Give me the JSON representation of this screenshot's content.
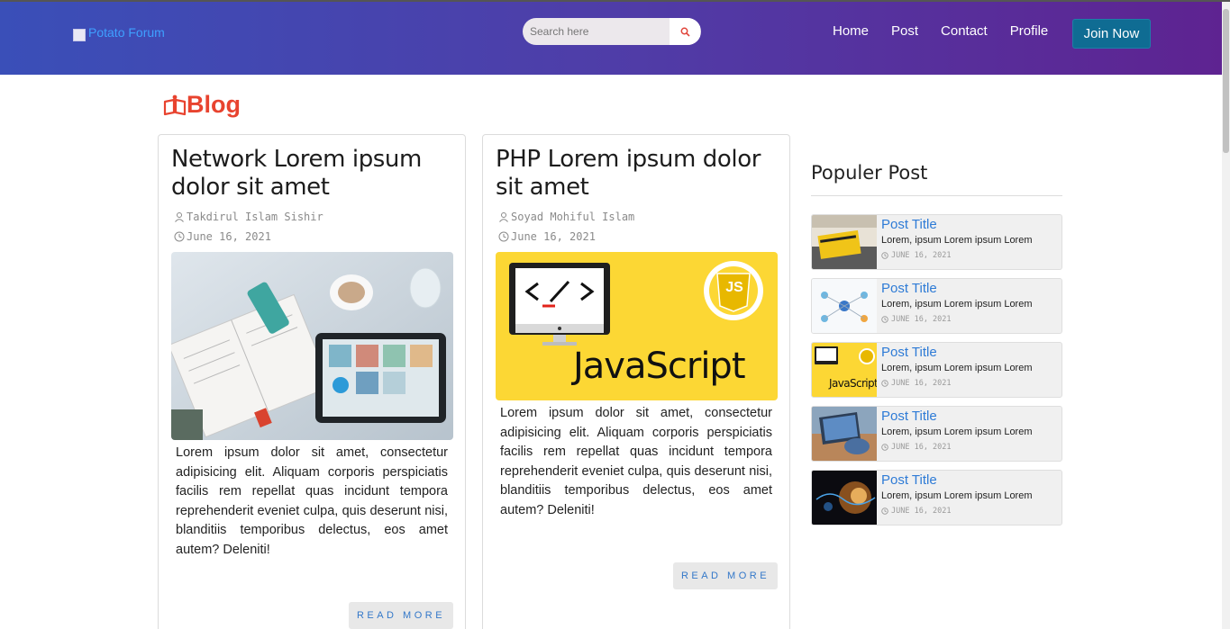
{
  "header": {
    "brand": "Potato Forum",
    "search_placeholder": "Search here",
    "nav": [
      "Home",
      "Post",
      "Contact",
      "Profile"
    ],
    "join": "Join Now"
  },
  "blog": {
    "heading": "Blog"
  },
  "posts": [
    {
      "title": "Network Lorem ipsum dolor sit amet",
      "author": "Takdirul Islam Sishir",
      "date": "June 16, 2021",
      "body": "Lorem ipsum dolor sit amet, consectetur adipisicing elit. Aliquam corporis perspiciatis facilis rem repellat quas incidunt tempora reprehenderit eveniet culpa, quis deserunt nisi, blanditiis temporibus delectus, eos amet autem? Deleniti!",
      "read_more": "READ MORE"
    },
    {
      "title": "PHP Lorem ipsum dolor sit amet",
      "author": "Soyad Mohiful Islam",
      "date": "June 16, 2021",
      "image_text": "JavaScript",
      "image_badge": "JS",
      "body": "Lorem ipsum dolor sit amet, consectetur adipisicing elit. Aliquam corporis perspiciatis facilis rem repellat quas incidunt tempora reprehenderit eveniet culpa, quis deserunt nisi, blanditiis temporibus delectus, eos amet autem? Deleniti!",
      "read_more": "READ MORE"
    }
  ],
  "sidebar": {
    "heading": "Populer Post",
    "items": [
      {
        "title": "Post Title",
        "desc": "Lorem, ipsum Lorem ipsum Lorem",
        "date": "JUNE 16, 2021"
      },
      {
        "title": "Post Title",
        "desc": "Lorem, ipsum Lorem ipsum Lorem",
        "date": "JUNE 16, 2021"
      },
      {
        "title": "Post Title",
        "desc": "Lorem, ipsum Lorem ipsum Lorem",
        "date": "JUNE 16, 2021",
        "thumb_text": "JavaScript"
      },
      {
        "title": "Post Title",
        "desc": "Lorem, ipsum Lorem ipsum Lorem",
        "date": "JUNE 16, 2021"
      },
      {
        "title": "Post Title",
        "desc": "Lorem, ipsum Lorem ipsum Lorem",
        "date": "JUNE 16, 2021"
      }
    ]
  },
  "colors": {
    "nav_gradient_start": "#3a4fb8",
    "nav_gradient_end": "#5e2391",
    "join_button": "#0f6c93",
    "blog_heading": "#e8432f",
    "link": "#2e7bd6"
  }
}
